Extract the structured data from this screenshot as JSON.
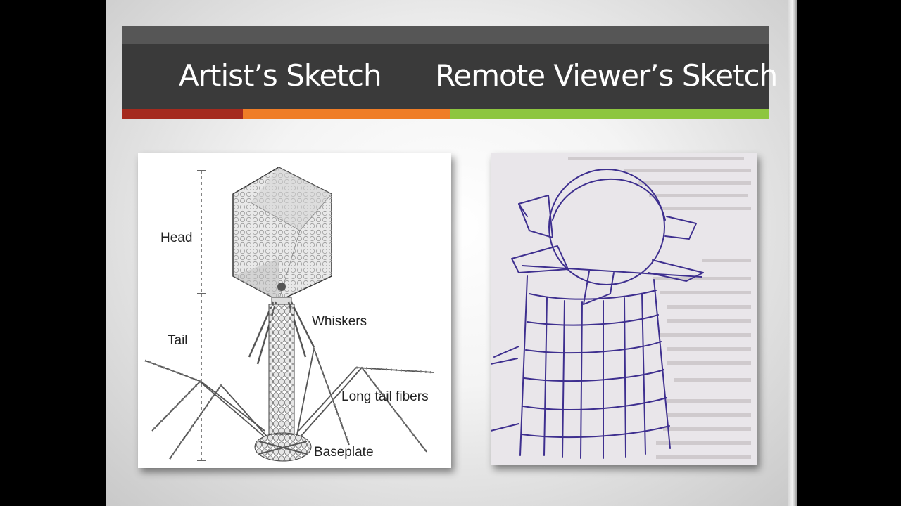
{
  "slide": {
    "title_left": "Artist’s Sketch",
    "title_right": "Remote Viewer’s Sketch",
    "accent_colors": [
      "#a52a1e",
      "#ef7d27",
      "#8dc63f"
    ]
  },
  "artist_sketch": {
    "labels": {
      "head": "Head",
      "tail": "Tail",
      "whiskers": "Whiskers",
      "long_tail_fibers": "Long tail fibers",
      "baseplate": "Baseplate"
    }
  }
}
